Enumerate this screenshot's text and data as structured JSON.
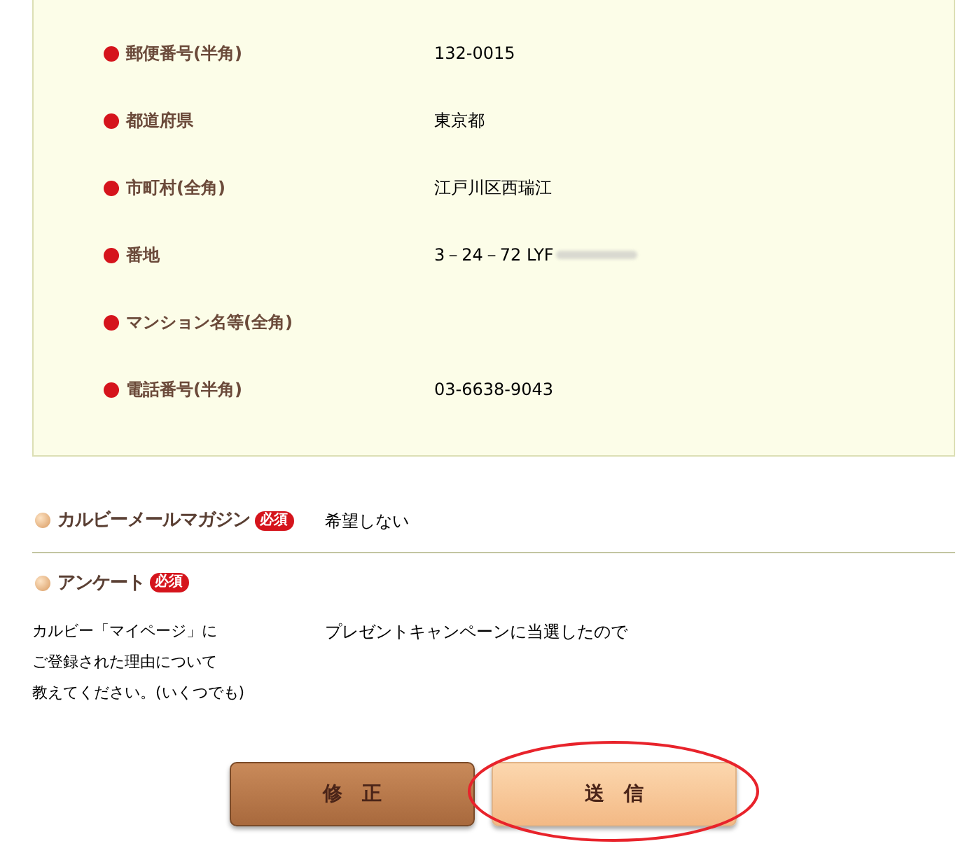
{
  "address_fields": [
    {
      "label": "郵便番号(半角)",
      "value": "132-0015"
    },
    {
      "label": "都道府県",
      "value": "東京都"
    },
    {
      "label": "市町村(全角)",
      "value": "江戸川区西瑞江"
    },
    {
      "label": "番地",
      "value": "3－24－72 LYF",
      "redacted": true
    },
    {
      "label": "マンション名等(全角)"
    },
    {
      "label": "電話番号(半角)",
      "value": "03-6638-9043"
    }
  ],
  "sections": [
    {
      "title": "カルビーメールマガジン",
      "badge": "必須",
      "answer": "希望しない",
      "divider": true
    },
    {
      "title": "アンケート",
      "badge": "必須",
      "question_lines": [
        "カルビー「マイページ」に",
        "ご登録された理由について",
        "教えてください。(いくつでも)"
      ],
      "answer": "プレゼントキャンペーンに当選したので",
      "divider": false
    }
  ],
  "buttons": [
    {
      "label": "修　正",
      "kind": "dark",
      "circled": false
    },
    {
      "label": "送　信",
      "kind": "light",
      "circled": true
    }
  ]
}
